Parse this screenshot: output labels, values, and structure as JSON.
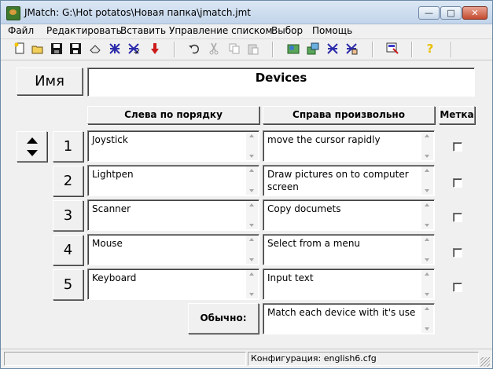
{
  "window": {
    "title": "JMatch: G:\\Hot potatos\\Новая папка\\jmatch.jmt",
    "minimize_glyph": "—",
    "maximize_glyph": "□",
    "close_glyph": "✕"
  },
  "menu": [
    "Файл",
    "Редактировать",
    "Вставить",
    "Управление списком",
    "Выбор",
    "Помощь"
  ],
  "toolbar": {
    "icons": [
      "new-file-icon",
      "open-folder-icon",
      "save-icon",
      "save-as-icon",
      "eraser-icon",
      "grid-icon",
      "grid-check-icon",
      "red-arrow-down-icon",
      "undo-icon",
      "cut-icon",
      "copy-icon",
      "paste-icon",
      "web-page-icon",
      "export-icon",
      "grid-export-icon",
      "grid-hand-icon",
      "config-icon",
      "help-icon"
    ]
  },
  "name_button": "Имя",
  "exercise_title": "Devices",
  "headers": {
    "left": "Слева по порядку",
    "right": "Справа произвольно",
    "mark": "Метка"
  },
  "rows": [
    {
      "num": "1",
      "left": "Joystick",
      "right": "move the cursor rapidly"
    },
    {
      "num": "2",
      "left": "Lightpen",
      "right": "Draw pictures on to computer screen"
    },
    {
      "num": "3",
      "left": "Scanner",
      "right": "Copy documets"
    },
    {
      "num": "4",
      "left": "Mouse",
      "right": "Select from a menu"
    },
    {
      "num": "5",
      "left": "Keyboard",
      "right": "Input text"
    }
  ],
  "default": {
    "label": "Обычно:",
    "value": "Match each device with it's use"
  },
  "status": {
    "left": "",
    "config": "Конфигурация: english6.cfg"
  },
  "colors": {
    "title_gradient_top": "#dbe7f4",
    "close_button": "#c44b2f",
    "stop_arrow": "#cc1a1a",
    "help_icon": "#e8c000"
  }
}
